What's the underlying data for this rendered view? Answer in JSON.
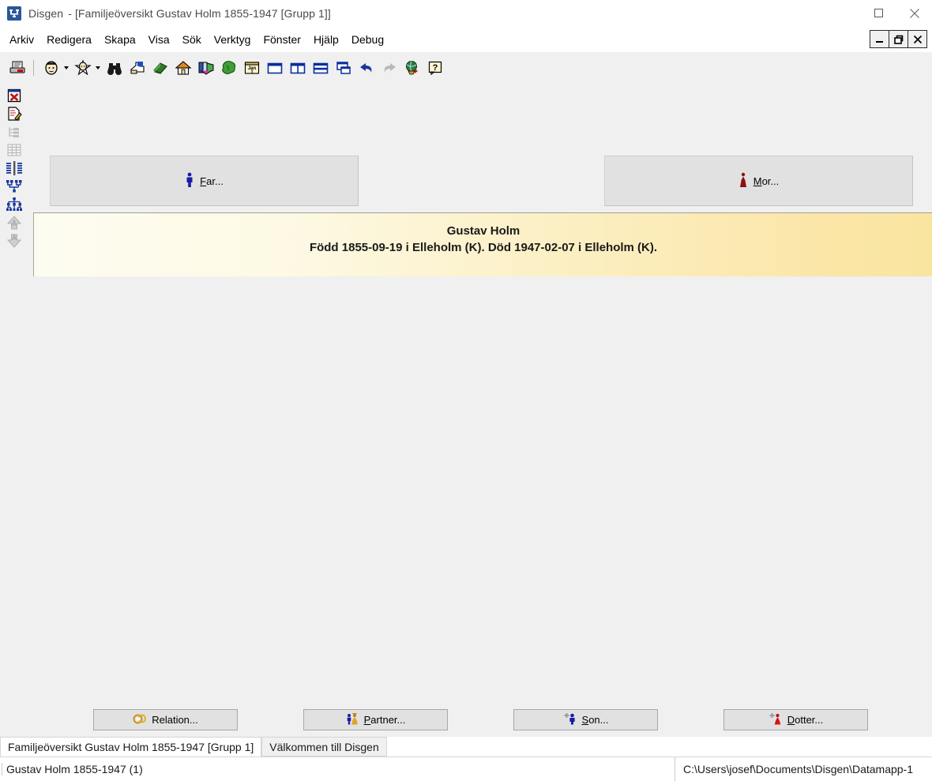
{
  "window": {
    "app_name": "Disgen",
    "doc_title": "- [Familjeöversikt Gustav Holm 1855-1947 [Grupp 1]]",
    "app_icon": "disgen-logo-icon",
    "controls": [
      {
        "name": "minimize-button",
        "glyph": "minimize-icon"
      },
      {
        "name": "maximize-button",
        "glyph": "maximize-icon"
      },
      {
        "name": "close-button",
        "glyph": "close-icon"
      }
    ],
    "mdi_controls": [
      {
        "name": "mdi-minimize-button",
        "glyph": "minimize-icon"
      },
      {
        "name": "mdi-restore-button",
        "glyph": "restore-icon"
      },
      {
        "name": "mdi-close-button",
        "glyph": "close-icon"
      }
    ]
  },
  "menu": {
    "items": [
      {
        "label": "Arkiv"
      },
      {
        "label": "Redigera"
      },
      {
        "label": "Skapa"
      },
      {
        "label": "Visa"
      },
      {
        "label": "Sök"
      },
      {
        "label": "Verktyg"
      },
      {
        "label": "Fönster"
      },
      {
        "label": "Hjälp"
      },
      {
        "label": "Debug"
      }
    ]
  },
  "toolbar": {
    "items": [
      {
        "name": "print-icon",
        "kind": "icon"
      },
      {
        "name": "separator",
        "kind": "sep"
      },
      {
        "name": "person-face-icon",
        "kind": "icon"
      },
      {
        "name": "person-dropdown-caret-icon",
        "kind": "caret"
      },
      {
        "name": "person-star-icon",
        "kind": "icon"
      },
      {
        "name": "person-star-dropdown-caret-icon",
        "kind": "caret"
      },
      {
        "name": "binoculars-search-icon",
        "kind": "icon"
      },
      {
        "name": "hand-pointer-icon",
        "kind": "icon"
      },
      {
        "name": "green-book-icon",
        "kind": "icon"
      },
      {
        "name": "house-icon",
        "kind": "icon"
      },
      {
        "name": "books-shelf-icon",
        "kind": "icon"
      },
      {
        "name": "green-tree-icon",
        "kind": "icon"
      },
      {
        "name": "calendar-jan-1-icon",
        "kind": "icon"
      },
      {
        "name": "window-single-icon",
        "kind": "icon"
      },
      {
        "name": "window-vertical-split-icon",
        "kind": "icon"
      },
      {
        "name": "window-horizontal-split-icon",
        "kind": "icon"
      },
      {
        "name": "window-cascade-icon",
        "kind": "icon"
      },
      {
        "name": "undo-arrow-icon",
        "kind": "icon"
      },
      {
        "name": "redo-arrow-icon",
        "kind": "icon"
      },
      {
        "name": "globe-icon",
        "kind": "icon"
      },
      {
        "name": "help-question-icon",
        "kind": "icon"
      }
    ]
  },
  "sidebar": {
    "items": [
      {
        "name": "close-document-icon"
      },
      {
        "name": "edit-document-icon"
      },
      {
        "name": "tree-outline-icon"
      },
      {
        "name": "table-grid-icon"
      },
      {
        "name": "family-chart-icon"
      },
      {
        "name": "ancestors-chart-icon"
      },
      {
        "name": "descendants-chart-icon"
      },
      {
        "name": "navigate-up-icon"
      },
      {
        "name": "navigate-down-icon"
      }
    ]
  },
  "main": {
    "father_button": {
      "label_pre": "",
      "accel": "F",
      "label_post": "ar...",
      "icon": "male-person-icon"
    },
    "mother_button": {
      "label_pre": "",
      "accel": "M",
      "label_post": "or...",
      "icon": "female-person-icon"
    },
    "person": {
      "name": "Gustav Holm",
      "dates": "Född 1855-09-19 i Elleholm (K). Död 1947-02-07 i Elleholm (K)."
    }
  },
  "actions": [
    {
      "name": "relation-button",
      "accel": "",
      "label_pre": "Relation...",
      "label_post": "",
      "icon": "wedding-rings-icon"
    },
    {
      "name": "partner-button",
      "accel": "P",
      "label_pre": "",
      "label_post": "artner...",
      "icon": "couple-icon"
    },
    {
      "name": "son-button",
      "accel": "S",
      "label_pre": "",
      "label_post": "on...",
      "icon": "add-son-icon"
    },
    {
      "name": "daughter-button",
      "accel": "D",
      "label_pre": "",
      "label_post": "otter...",
      "icon": "add-daughter-icon"
    }
  ],
  "tabs": [
    {
      "label": "Familjeöversikt Gustav Holm 1855-1947 [Grupp 1]",
      "active": true
    },
    {
      "label": "Välkommen till Disgen",
      "active": false
    }
  ],
  "status": {
    "left": "Gustav Holm 1855-1947 (1)",
    "right": "C:\\Users\\josef\\Documents\\Disgen\\Datamapp-1"
  },
  "colors": {
    "panel_gradient_start": "#fdfcf1",
    "panel_gradient_end": "#fae59f",
    "chrome_gray": "#f0f0f0",
    "button_face": "#e1e1e1",
    "male_blue": "#1a1aa8",
    "female_red": "#b01010"
  }
}
